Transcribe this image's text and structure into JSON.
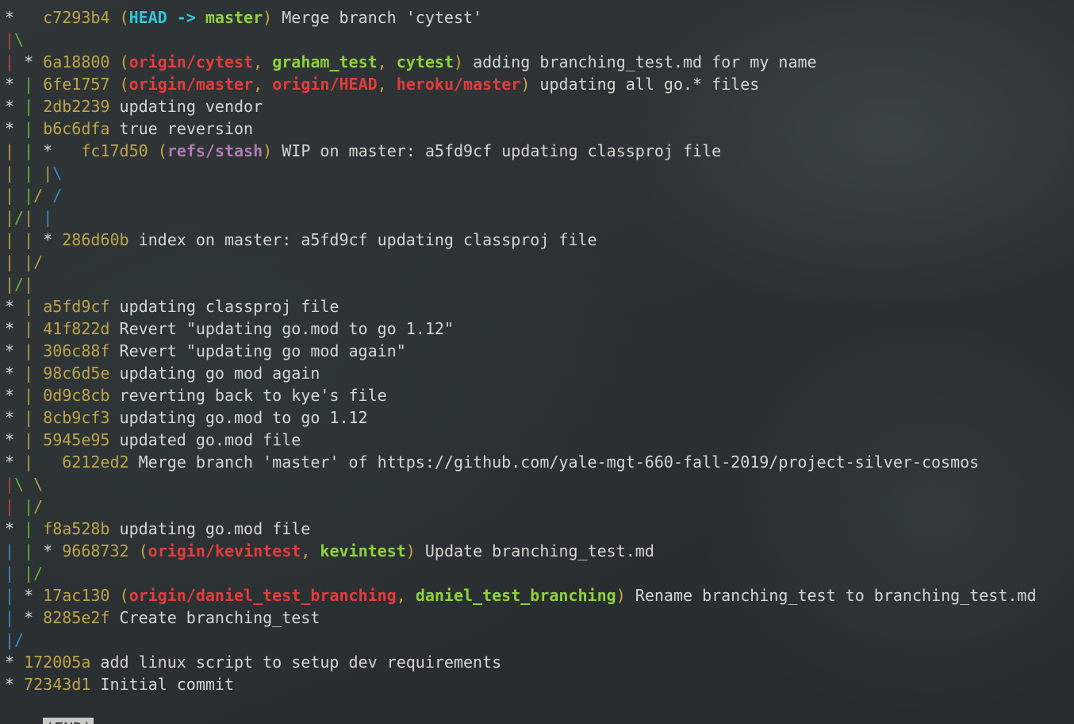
{
  "colors": {
    "default": "#d3d5d2",
    "hash": "#bda349",
    "paren": "#c9a53c",
    "comma": "#d3d5d2",
    "head": "#2fc6d6",
    "local_branch": "#8fd13a",
    "remote_branch": "#e53b3b",
    "stash": "#b07bb4",
    "graph_red": "#c23b3b",
    "graph_green": "#6bae34",
    "graph_blue": "#3f86c6",
    "graph_gold": "#b79d45"
  },
  "lines": [
    {
      "segments": [
        {
          "t": "*   ",
          "c": "default"
        },
        {
          "t": "c7293b4",
          "c": "hash"
        },
        {
          "t": " (",
          "c": "paren"
        },
        {
          "t": "HEAD -> ",
          "c": "head",
          "b": true
        },
        {
          "t": "master",
          "c": "local_branch",
          "b": true
        },
        {
          "t": ")",
          "c": "paren"
        },
        {
          "t": " Merge branch 'cytest'",
          "c": "default"
        }
      ]
    },
    {
      "segments": [
        {
          "t": "|",
          "c": "graph_red"
        },
        {
          "t": "\\",
          "c": "graph_green"
        }
      ]
    },
    {
      "segments": [
        {
          "t": "|",
          "c": "graph_red"
        },
        {
          "t": " * ",
          "c": "default"
        },
        {
          "t": "6a18800",
          "c": "hash"
        },
        {
          "t": " (",
          "c": "paren"
        },
        {
          "t": "origin/cytest",
          "c": "remote_branch",
          "b": true
        },
        {
          "t": ", ",
          "c": "paren"
        },
        {
          "t": "graham_test",
          "c": "local_branch",
          "b": true
        },
        {
          "t": ", ",
          "c": "paren"
        },
        {
          "t": "cytest",
          "c": "local_branch",
          "b": true
        },
        {
          "t": ")",
          "c": "paren"
        },
        {
          "t": " adding branching_test.md for my name",
          "c": "default"
        }
      ]
    },
    {
      "segments": [
        {
          "t": "* ",
          "c": "default"
        },
        {
          "t": "|",
          "c": "graph_green"
        },
        {
          "t": " ",
          "c": "default"
        },
        {
          "t": "6fe1757",
          "c": "hash"
        },
        {
          "t": " (",
          "c": "paren"
        },
        {
          "t": "origin/master",
          "c": "remote_branch",
          "b": true
        },
        {
          "t": ", ",
          "c": "paren"
        },
        {
          "t": "origin/HEAD",
          "c": "remote_branch",
          "b": true
        },
        {
          "t": ", ",
          "c": "paren"
        },
        {
          "t": "heroku/master",
          "c": "remote_branch",
          "b": true
        },
        {
          "t": ")",
          "c": "paren"
        },
        {
          "t": " updating all go.* files",
          "c": "default"
        }
      ]
    },
    {
      "segments": [
        {
          "t": "* ",
          "c": "default"
        },
        {
          "t": "|",
          "c": "graph_green"
        },
        {
          "t": " ",
          "c": "default"
        },
        {
          "t": "2db2239",
          "c": "hash"
        },
        {
          "t": " updating vendor",
          "c": "default"
        }
      ]
    },
    {
      "segments": [
        {
          "t": "* ",
          "c": "default"
        },
        {
          "t": "|",
          "c": "graph_green"
        },
        {
          "t": " ",
          "c": "default"
        },
        {
          "t": "b6c6dfa",
          "c": "hash"
        },
        {
          "t": " true reversion",
          "c": "default"
        }
      ]
    },
    {
      "segments": [
        {
          "t": "|",
          "c": "graph_gold"
        },
        {
          "t": " ",
          "c": "default"
        },
        {
          "t": "|",
          "c": "graph_green"
        },
        {
          "t": " *   ",
          "c": "default"
        },
        {
          "t": "fc17d50",
          "c": "hash"
        },
        {
          "t": " (",
          "c": "paren"
        },
        {
          "t": "refs/stash",
          "c": "stash",
          "b": true
        },
        {
          "t": ")",
          "c": "paren"
        },
        {
          "t": " WIP on master: a5fd9cf updating classproj file",
          "c": "default"
        }
      ]
    },
    {
      "segments": [
        {
          "t": "|",
          "c": "graph_gold"
        },
        {
          "t": " ",
          "c": "default"
        },
        {
          "t": "|",
          "c": "graph_green"
        },
        {
          "t": " ",
          "c": "default"
        },
        {
          "t": "|",
          "c": "graph_gold"
        },
        {
          "t": "\\",
          "c": "graph_blue"
        }
      ]
    },
    {
      "segments": [
        {
          "t": "|",
          "c": "graph_gold"
        },
        {
          "t": " ",
          "c": "default"
        },
        {
          "t": "|",
          "c": "graph_green"
        },
        {
          "t": "/",
          "c": "graph_gold"
        },
        {
          "t": " ",
          "c": "default"
        },
        {
          "t": "/",
          "c": "graph_blue"
        }
      ]
    },
    {
      "segments": [
        {
          "t": "|",
          "c": "graph_gold"
        },
        {
          "t": "/",
          "c": "graph_green"
        },
        {
          "t": "|",
          "c": "graph_gold"
        },
        {
          "t": " ",
          "c": "default"
        },
        {
          "t": "|",
          "c": "graph_blue"
        }
      ]
    },
    {
      "segments": [
        {
          "t": "|",
          "c": "graph_gold"
        },
        {
          "t": " ",
          "c": "default"
        },
        {
          "t": "|",
          "c": "graph_gold"
        },
        {
          "t": " * ",
          "c": "default"
        },
        {
          "t": "286d60b",
          "c": "hash"
        },
        {
          "t": " index on master: a5fd9cf updating classproj file",
          "c": "default"
        }
      ]
    },
    {
      "segments": [
        {
          "t": "|",
          "c": "graph_gold"
        },
        {
          "t": " ",
          "c": "default"
        },
        {
          "t": "|",
          "c": "graph_gold"
        },
        {
          "t": "/",
          "c": "graph_gold"
        }
      ]
    },
    {
      "segments": [
        {
          "t": "|",
          "c": "graph_gold"
        },
        {
          "t": "/",
          "c": "graph_green"
        },
        {
          "t": "|",
          "c": "graph_gold"
        }
      ]
    },
    {
      "segments": [
        {
          "t": "* ",
          "c": "default"
        },
        {
          "t": "|",
          "c": "graph_gold"
        },
        {
          "t": " ",
          "c": "default"
        },
        {
          "t": "a5fd9cf",
          "c": "hash"
        },
        {
          "t": " updating classproj file",
          "c": "default"
        }
      ]
    },
    {
      "segments": [
        {
          "t": "* ",
          "c": "default"
        },
        {
          "t": "|",
          "c": "graph_gold"
        },
        {
          "t": " ",
          "c": "default"
        },
        {
          "t": "41f822d",
          "c": "hash"
        },
        {
          "t": " Revert \"updating go.mod to go 1.12\"",
          "c": "default"
        }
      ]
    },
    {
      "segments": [
        {
          "t": "* ",
          "c": "default"
        },
        {
          "t": "|",
          "c": "graph_gold"
        },
        {
          "t": " ",
          "c": "default"
        },
        {
          "t": "306c88f",
          "c": "hash"
        },
        {
          "t": " Revert \"updating go mod again\"",
          "c": "default"
        }
      ]
    },
    {
      "segments": [
        {
          "t": "* ",
          "c": "default"
        },
        {
          "t": "|",
          "c": "graph_gold"
        },
        {
          "t": " ",
          "c": "default"
        },
        {
          "t": "98c6d5e",
          "c": "hash"
        },
        {
          "t": " updating go mod again",
          "c": "default"
        }
      ]
    },
    {
      "segments": [
        {
          "t": "* ",
          "c": "default"
        },
        {
          "t": "|",
          "c": "graph_gold"
        },
        {
          "t": " ",
          "c": "default"
        },
        {
          "t": "0d9c8cb",
          "c": "hash"
        },
        {
          "t": " reverting back to kye's file",
          "c": "default"
        }
      ]
    },
    {
      "segments": [
        {
          "t": "* ",
          "c": "default"
        },
        {
          "t": "|",
          "c": "graph_gold"
        },
        {
          "t": " ",
          "c": "default"
        },
        {
          "t": "8cb9cf3",
          "c": "hash"
        },
        {
          "t": " updating go.mod to go 1.12",
          "c": "default"
        }
      ]
    },
    {
      "segments": [
        {
          "t": "* ",
          "c": "default"
        },
        {
          "t": "|",
          "c": "graph_gold"
        },
        {
          "t": " ",
          "c": "default"
        },
        {
          "t": "5945e95",
          "c": "hash"
        },
        {
          "t": " updated go.mod file",
          "c": "default"
        }
      ]
    },
    {
      "segments": [
        {
          "t": "* ",
          "c": "default"
        },
        {
          "t": "|",
          "c": "graph_gold"
        },
        {
          "t": "   ",
          "c": "default"
        },
        {
          "t": "6212ed2",
          "c": "hash"
        },
        {
          "t": " Merge branch 'master' of https://github.com/yale-mgt-660-fall-2019/project-silver-cosmos",
          "c": "default"
        }
      ]
    },
    {
      "segments": [
        {
          "t": "|",
          "c": "graph_red"
        },
        {
          "t": "\\",
          "c": "graph_green"
        },
        {
          "t": " ",
          "c": "default"
        },
        {
          "t": "\\",
          "c": "graph_gold"
        }
      ]
    },
    {
      "segments": [
        {
          "t": "|",
          "c": "graph_red"
        },
        {
          "t": " ",
          "c": "default"
        },
        {
          "t": "|",
          "c": "graph_green"
        },
        {
          "t": "/",
          "c": "graph_gold"
        }
      ]
    },
    {
      "segments": [
        {
          "t": "* ",
          "c": "default"
        },
        {
          "t": "|",
          "c": "graph_green"
        },
        {
          "t": " ",
          "c": "default"
        },
        {
          "t": "f8a528b",
          "c": "hash"
        },
        {
          "t": " updating go.mod file",
          "c": "default"
        }
      ]
    },
    {
      "segments": [
        {
          "t": "|",
          "c": "graph_blue"
        },
        {
          "t": " ",
          "c": "default"
        },
        {
          "t": "|",
          "c": "graph_green"
        },
        {
          "t": " * ",
          "c": "default"
        },
        {
          "t": "9668732",
          "c": "hash"
        },
        {
          "t": " (",
          "c": "paren"
        },
        {
          "t": "origin/kevintest",
          "c": "remote_branch",
          "b": true
        },
        {
          "t": ", ",
          "c": "paren"
        },
        {
          "t": "kevintest",
          "c": "local_branch",
          "b": true
        },
        {
          "t": ")",
          "c": "paren"
        },
        {
          "t": " Update branching_test.md",
          "c": "default"
        }
      ]
    },
    {
      "segments": [
        {
          "t": "|",
          "c": "graph_blue"
        },
        {
          "t": " ",
          "c": "default"
        },
        {
          "t": "|",
          "c": "graph_green"
        },
        {
          "t": "/",
          "c": "graph_green"
        }
      ]
    },
    {
      "segments": [
        {
          "t": "|",
          "c": "graph_blue"
        },
        {
          "t": " * ",
          "c": "default"
        },
        {
          "t": "17ac130",
          "c": "hash"
        },
        {
          "t": " (",
          "c": "paren"
        },
        {
          "t": "origin/daniel_test_branching",
          "c": "remote_branch",
          "b": true
        },
        {
          "t": ", ",
          "c": "paren"
        },
        {
          "t": "daniel_test_branching",
          "c": "local_branch",
          "b": true
        },
        {
          "t": ")",
          "c": "paren"
        },
        {
          "t": " Rename branching_test to branching_test.md",
          "c": "default"
        }
      ]
    },
    {
      "segments": [
        {
          "t": "|",
          "c": "graph_blue"
        },
        {
          "t": " * ",
          "c": "default"
        },
        {
          "t": "8285e2f",
          "c": "hash"
        },
        {
          "t": " Create branching_test",
          "c": "default"
        }
      ]
    },
    {
      "segments": [
        {
          "t": "|",
          "c": "graph_blue"
        },
        {
          "t": "/",
          "c": "graph_blue"
        }
      ]
    },
    {
      "segments": [
        {
          "t": "* ",
          "c": "default"
        },
        {
          "t": "172005a",
          "c": "hash"
        },
        {
          "t": " add linux script to setup dev requirements",
          "c": "default"
        }
      ]
    },
    {
      "segments": [
        {
          "t": "* ",
          "c": "default"
        },
        {
          "t": "72343d1",
          "c": "hash"
        },
        {
          "t": " Initial commit",
          "c": "default"
        }
      ]
    }
  ],
  "status": "(END)"
}
